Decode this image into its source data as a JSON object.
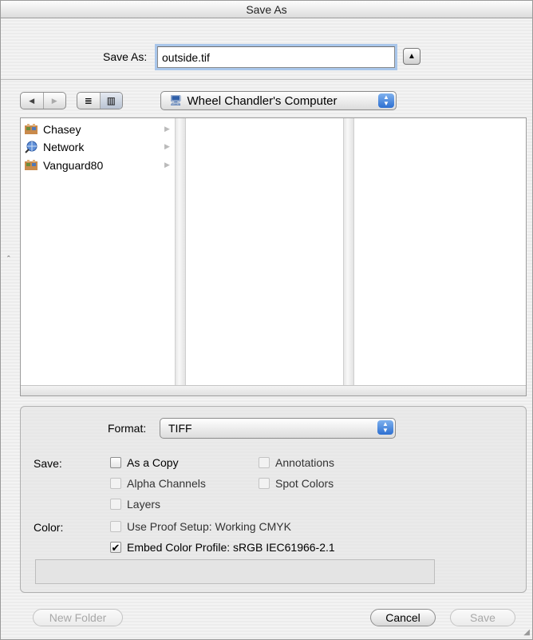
{
  "window": {
    "title": "Save As"
  },
  "save_as": {
    "label": "Save As:",
    "value": "outside.tif"
  },
  "toolbar": {
    "back": "◀",
    "forward": "▶",
    "list_view": "≣",
    "column_view": "▥",
    "location": "Wheel Chandler's Computer"
  },
  "browser": {
    "items": [
      {
        "label": "Chasey",
        "icon": "network-volume-icon"
      },
      {
        "label": "Network",
        "icon": "network-globe-icon"
      },
      {
        "label": "Vanguard80",
        "icon": "network-volume-icon"
      }
    ]
  },
  "options": {
    "format_label": "Format:",
    "format_value": "TIFF",
    "save_label": "Save:",
    "color_label": "Color:",
    "as_a_copy": "As a Copy",
    "annotations": "Annotations",
    "alpha_channels": "Alpha Channels",
    "spot_colors": "Spot Colors",
    "layers": "Layers",
    "use_proof_setup": "Use Proof Setup:  Working CMYK",
    "embed_color_profile": "Embed Color Profile:  sRGB IEC61966-2.1",
    "embed_checked": true
  },
  "buttons": {
    "new_folder": "New Folder",
    "cancel": "Cancel",
    "save": "Save"
  }
}
